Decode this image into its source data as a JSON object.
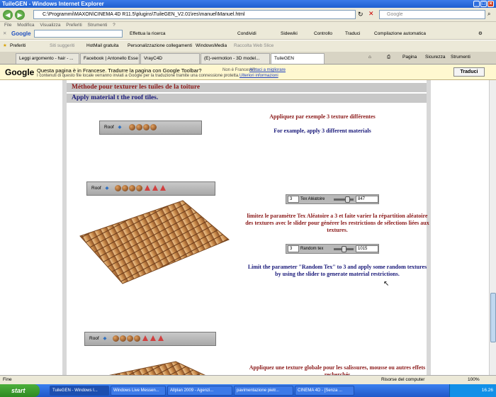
{
  "window": {
    "title": "TuileGEN - Windows Internet Explorer"
  },
  "address": {
    "url": "C:\\Programmi\\MAXON\\CINEMA 4D R11.5\\plugins\\TuileGEN_V2.01\\res\\manuel\\Manuel.html",
    "search_placeholder": "Google"
  },
  "menu": [
    "File",
    "Modifica",
    "Visualizza",
    "Preferiti",
    "Strumenti",
    "?"
  ],
  "google_toolbar": {
    "logo": "Google",
    "items": [
      "Effettua la ricerca",
      "Condividi",
      "Sidewiki",
      "Controllo",
      "Traduci",
      "Compilazione automatica"
    ]
  },
  "favorites": {
    "label": "Preferiti",
    "items": [
      "Siti suggeriti",
      "HotMail gratuita",
      "Personalizzazione collegamenti",
      "WindowsMedia",
      "Raccolta Web Slice"
    ]
  },
  "tabs": [
    {
      "label": "Leggi argomento - hair - ..."
    },
    {
      "label": "Facebook | Antonello Esse"
    },
    {
      "label": "VrayC4D"
    },
    {
      "label": "(E)-vermotion - 3D model..."
    },
    {
      "label": "TuileGEN"
    }
  ],
  "page_tools": [
    "Pagina",
    "Sicurezza",
    "Strumenti"
  ],
  "translate_bar": {
    "logo": "Google",
    "question": "Questa pagina è in Francese. Tradurre la pagina con Google Toolbar?",
    "not_french": "Non è Francese?",
    "help": "Aiutaci a migliorare",
    "note": "I contenuti di questo file locale verranno inviati a Google per la traduzione tramite una connessione protetta.",
    "more": "Ulteriori informazioni",
    "button": "Traduci"
  },
  "page": {
    "heading_fr": "Méthode pour texturer les tuiles de la toiture",
    "heading_en": "Apply material t the roof tiles.",
    "bar_label": "Roof",
    "p1_fr": "Appliquez par exemple 3 texture différentes",
    "p1_en": "For example, apply 3 different materials",
    "slider1": {
      "count": "3",
      "label": "Tex Aléatoire",
      "value": "847"
    },
    "p2_fr": "limitez le paramètre Tex Aléatoire a 3 et faite varier la répartition aléatoire des textures avec le slider pour générer les restrictions de sélections liées aux textures.",
    "slider2": {
      "count": "3",
      "label": "Random tex",
      "value": "1015"
    },
    "p2_en": "Limit the parameter \"Random Tex\" to 3 and apply some random textures by using the slider to generate material restrictions.",
    "p3_fr": "Appliquez une texture globale pour les salissures, mousse ou autres effets recherchés"
  },
  "status": {
    "left": "Fine",
    "zone": "Risorse del computer",
    "zoom": "100%"
  },
  "taskbar": {
    "start": "start",
    "tasks": [
      "TuileGEN - Windows I...",
      "Windows Live Messen...",
      "Allplan 2009 - Agenzi...",
      "pavimentazione pietr...",
      "CINEMA 4D - [Senza ..."
    ],
    "clock": "16.26"
  },
  "colors": {
    "french_text": "#8b1a1a",
    "english_text": "#1a1a7a",
    "header_bg": "#c8c8c8"
  },
  "icons": [
    "back-icon",
    "forward-icon",
    "refresh-icon",
    "stop-icon",
    "search-icon",
    "star-icon",
    "home-icon",
    "print-icon",
    "scroll-thumb"
  ]
}
